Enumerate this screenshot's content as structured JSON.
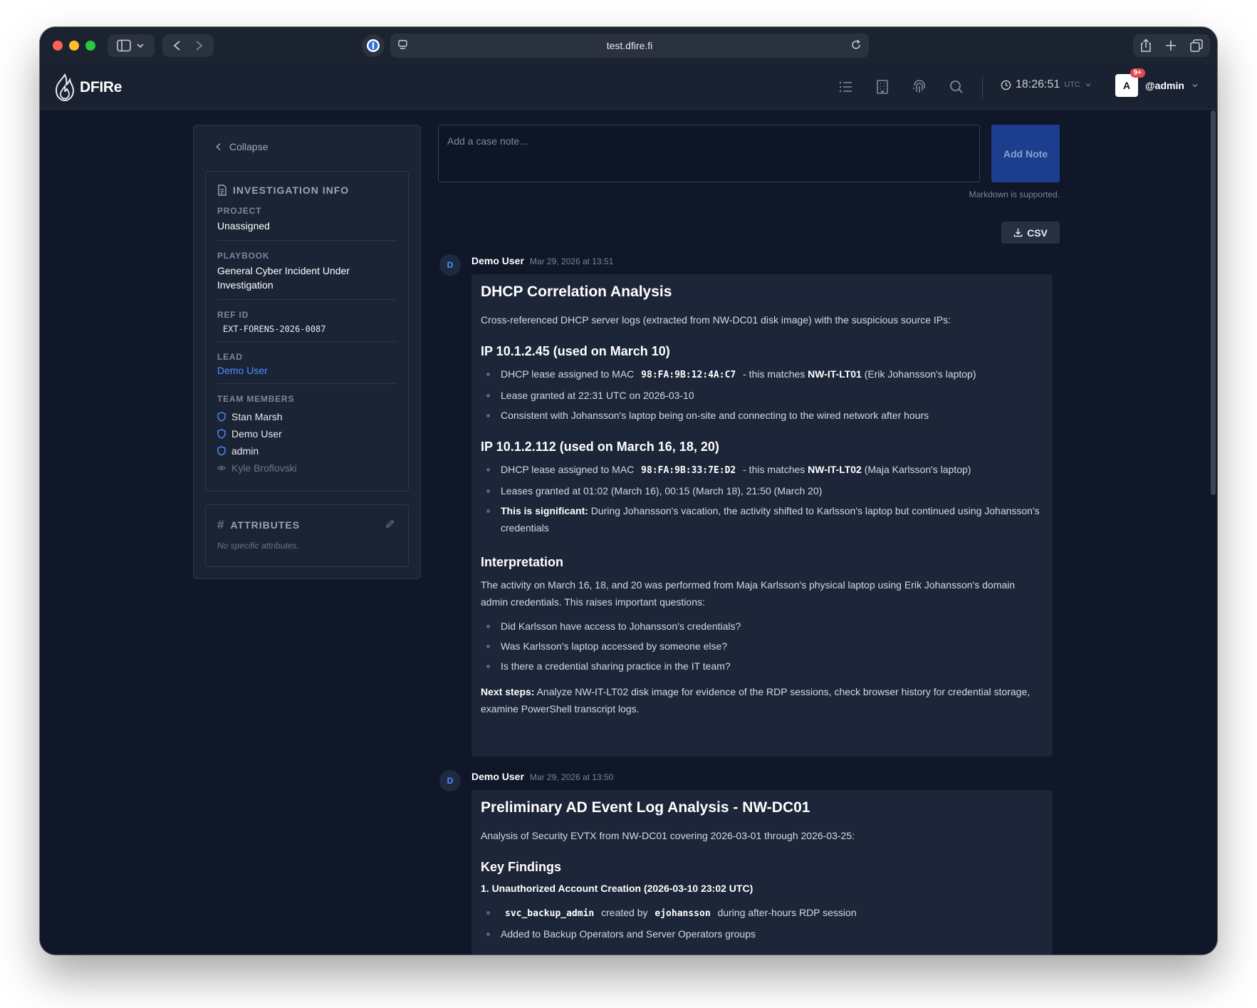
{
  "browser": {
    "url": "test.dfire.fi"
  },
  "app": {
    "logo_text": "DFIRe",
    "clock": "18:26:51",
    "timezone": "UTC",
    "notification_count": "9+",
    "avatar_letter": "A",
    "username": "@admin"
  },
  "sidebar": {
    "collapse_label": "Collapse",
    "info_title": "INVESTIGATION INFO",
    "project_label": "PROJECT",
    "project_value": "Unassigned",
    "playbook_label": "PLAYBOOK",
    "playbook_value": "General Cyber Incident Under Investigation",
    "ref_label": "REF ID",
    "ref_value": "EXT-FORENS-2026-0087",
    "lead_label": "LEAD",
    "lead_value": "Demo User",
    "team_label": "TEAM MEMBERS",
    "members": [
      {
        "name": "Stan Marsh",
        "icon": "shield-icon"
      },
      {
        "name": "Demo User",
        "icon": "shield-icon"
      },
      {
        "name": "admin",
        "icon": "shield-icon"
      },
      {
        "name": "Kyle Broflovski",
        "icon": "eye-icon"
      }
    ],
    "attributes_title": "ATTRIBUTES",
    "attributes_empty": "No specific attributes."
  },
  "composer": {
    "placeholder": "Add a case note...",
    "add_button": "Add Note",
    "markdown_hint": "Markdown is supported.",
    "csv_button": "CSV"
  },
  "notes": [
    {
      "avatar": "D",
      "author": "Demo User",
      "time": "Mar 29, 2026 at 13:51",
      "title": "DHCP Correlation Analysis",
      "intro": "Cross-referenced DHCP server logs (extracted from NW-DC01 disk image) with the suspicious source IPs:",
      "s1_title": "IP 10.1.2.45 (used on March 10)",
      "s1_b1_pre": "DHCP lease assigned to MAC",
      "s1_b1_mac": "98:FA:9B:12:4A:C7",
      "s1_b1_mid": "- this matches",
      "s1_b1_host": "NW-IT-LT01",
      "s1_b1_post": "(Erik Johansson's laptop)",
      "s1_b2": "Lease granted at 22:31 UTC on 2026-03-10",
      "s1_b3": "Consistent with Johansson's laptop being on-site and connecting to the wired network after hours",
      "s2_title": "IP 10.1.2.112 (used on March 16, 18, 20)",
      "s2_b1_pre": "DHCP lease assigned to MAC",
      "s2_b1_mac": "98:FA:9B:33:7E:D2",
      "s2_b1_mid": "- this matches",
      "s2_b1_host": "NW-IT-LT02",
      "s2_b1_post": "(Maja Karlsson's laptop)",
      "s2_b2": "Leases granted at 01:02 (March 16), 00:15 (March 18), 21:50 (March 20)",
      "s2_b3_bold": "This is significant:",
      "s2_b3_text": "During Johansson's vacation, the activity shifted to Karlsson's laptop but continued using Johansson's credentials",
      "s3_title": "Interpretation",
      "s3_text": "The activity on March 16, 18, and 20 was performed from Maja Karlsson's physical laptop using Erik Johansson's domain admin credentials. This raises important questions:",
      "s3_q1": "Did Karlsson have access to Johansson's credentials?",
      "s3_q2": "Was Karlsson's laptop accessed by someone else?",
      "s3_q3": "Is there a credential sharing practice in the IT team?",
      "next_bold": "Next steps:",
      "next_text": "Analyze NW-IT-LT02 disk image for evidence of the RDP sessions, check browser history for credential storage, examine PowerShell transcript logs."
    },
    {
      "avatar": "D",
      "author": "Demo User",
      "time": "Mar 29, 2026 at 13:50",
      "title": "Preliminary AD Event Log Analysis - NW-DC01",
      "intro": "Analysis of Security EVTX from NW-DC01 covering 2026-03-01 through 2026-03-25:",
      "s1_title": "Key Findings",
      "f1_title": "1. Unauthorized Account Creation (2026-03-10 23:02 UTC)",
      "f1_b1_account": "svc_backup_admin",
      "f1_b1_mid": "created by",
      "f1_b1_user": "ejohansson",
      "f1_b1_post": "during after-hours RDP session",
      "f1_b2": "Added to Backup Operators and Server Operators groups"
    }
  ]
}
